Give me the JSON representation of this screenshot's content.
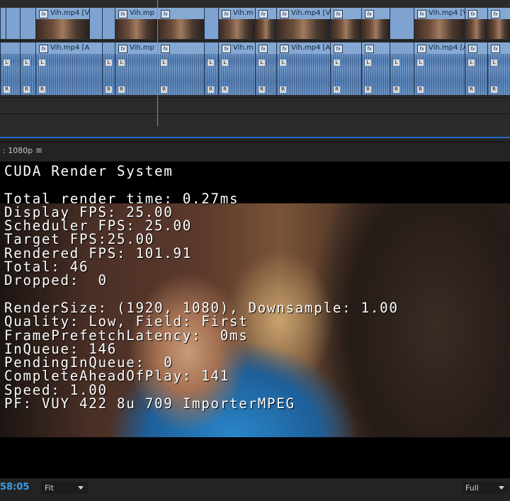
{
  "timeline": {
    "video_clips": [
      {
        "label": "Vih.mp4 [V"
      },
      {
        "label": "Vih.mp"
      },
      {
        "label": "Vih.m"
      },
      {
        "label": "Vih.mp4 [V"
      },
      {
        "label": "Vih.mp4 [V"
      }
    ],
    "audio_clips": [
      {
        "label": "Vih.mp4 [A"
      },
      {
        "label": "Vih.mp"
      },
      {
        "label": "Vih.m"
      },
      {
        "label": "Vih.mp4 [A"
      },
      {
        "label": "Vih.mp4 [A"
      }
    ],
    "channel_left": "L",
    "channel_right": "R",
    "fx_badge": "fx"
  },
  "monitor": {
    "title": ": 1080p",
    "menu_glyph": "≡"
  },
  "overlay": {
    "title": "CUDA Render System",
    "lines_a": [
      "Total render time: 0.27ms",
      "Display FPS: 25.00",
      "Scheduler FPS: 25.00",
      "Target FPS:25.00",
      "Rendered FPS: 101.91",
      "Total: 46",
      "Dropped:  0"
    ],
    "lines_b": [
      "RenderSize: (1920, 1080), Downsample: 1.00",
      "Quality: Low, Field: First",
      "FramePrefetchLatency:  0ms",
      "InQueue: 146",
      "PendingInQueue:  0",
      "CompleteAheadOfPlay: 141",
      "Speed: 1.00",
      "PF: VUY 422 8u 709 ImporterMPEG"
    ]
  },
  "bottom_bar": {
    "timecode": "58:05",
    "zoom": "Fit",
    "resolution": "Full"
  },
  "colors": {
    "accent": "#3b9ee8",
    "clip_blue": "#7ea3d1",
    "playhead": "#3fa0ff"
  }
}
